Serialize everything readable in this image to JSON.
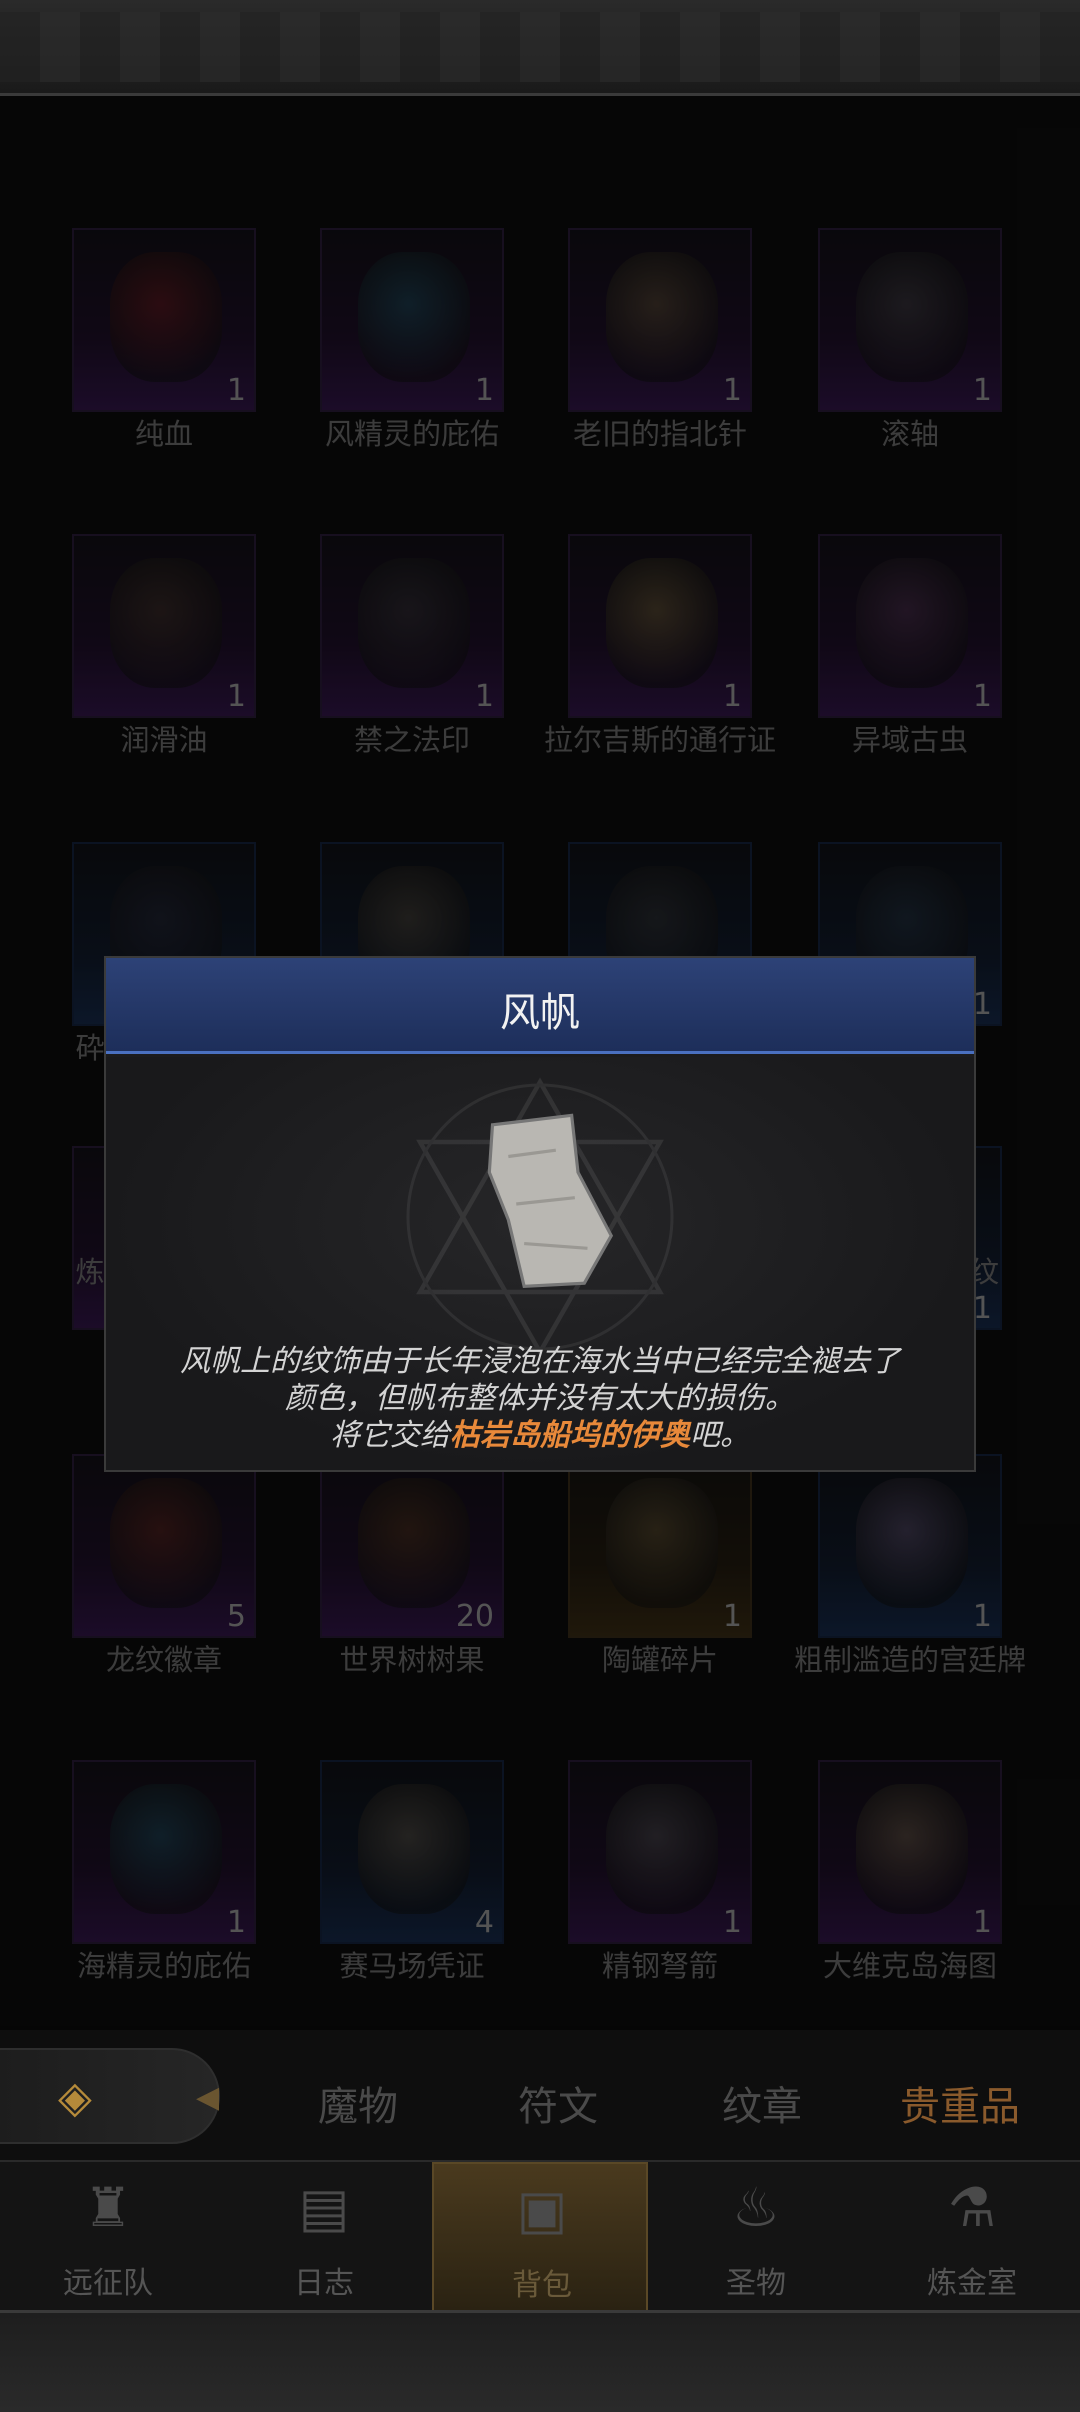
{
  "items": [
    {
      "name": "纯血",
      "qty": "1",
      "rarity": "purple",
      "color": "#7a1d1d"
    },
    {
      "name": "风精灵的庇佑",
      "qty": "1",
      "rarity": "purple",
      "color": "#1f5a6a"
    },
    {
      "name": "老旧的指北针",
      "qty": "1",
      "rarity": "purple",
      "color": "#6a5a3a"
    },
    {
      "name": "滚轴",
      "qty": "1",
      "rarity": "purple",
      "color": "#4a4a4a"
    },
    {
      "name": "润滑油",
      "qty": "1",
      "rarity": "purple",
      "color": "#4a3a2a"
    },
    {
      "name": "禁之法印",
      "qty": "1",
      "rarity": "purple",
      "color": "#3a3a3a"
    },
    {
      "name": "拉尔吉斯的通行证",
      "qty": "1",
      "rarity": "purple",
      "color": "#7a6a3a"
    },
    {
      "name": "异域古虫",
      "qty": "1",
      "rarity": "purple",
      "color": "#5a3a5a"
    },
    {
      "name": "",
      "qty": "",
      "rarity": "blue",
      "color": "#2a2a3a"
    },
    {
      "name": "",
      "qty": "",
      "rarity": "blue",
      "color": "#5a5040"
    },
    {
      "name": "",
      "qty": "",
      "rarity": "blue",
      "color": "#3a3a3a"
    },
    {
      "name": "",
      "qty": "1",
      "rarity": "blue",
      "color": "#2a3a4a"
    },
    {
      "name": "",
      "qty": "",
      "rarity": "purple",
      "color": "#2a2a2a"
    },
    {
      "name": "",
      "qty": "",
      "rarity": "purple",
      "color": "#2a2a2a"
    },
    {
      "name": "",
      "qty": "",
      "rarity": "purple",
      "color": "#2a2a2a"
    },
    {
      "name": "",
      "qty": "1",
      "rarity": "blue",
      "color": "#2a2a2a"
    },
    {
      "name": "龙纹徽章",
      "qty": "5",
      "rarity": "purple",
      "color": "#6a2a1a"
    },
    {
      "name": "世界树树果",
      "qty": "20",
      "rarity": "purple",
      "color": "#5a3a1a"
    },
    {
      "name": "陶罐碎片",
      "qty": "1",
      "rarity": "gold",
      "color": "#6a5a3a"
    },
    {
      "name": "粗制滥造的宫廷牌",
      "qty": "1",
      "rarity": "blue",
      "color": "#6a5a7a"
    },
    {
      "name": "海精灵的庇佑",
      "qty": "1",
      "rarity": "purple",
      "color": "#1f5a6a"
    },
    {
      "name": "赛马场凭证",
      "qty": "4",
      "rarity": "blue",
      "color": "#6a6050"
    },
    {
      "name": "精钢弩箭",
      "qty": "1",
      "rarity": "purple",
      "color": "#5a5a5a"
    },
    {
      "name": "大维克岛海图",
      "qty": "1",
      "rarity": "purple",
      "color": "#7a6a50"
    }
  ],
  "partial_labels": {
    "row3_left": "砕",
    "row4_left": "炼",
    "row4_right": "徽纹"
  },
  "dialog": {
    "title": "风帆",
    "desc_line1": "风帆上的纹饰由于长年浸泡在海水当中已经完全褪去了",
    "desc_line2": "颜色，但帆布整体并没有太大的损伤。",
    "desc_line3_pre": "将它交给",
    "desc_line3_hl": "枯岩岛船坞的伊奥",
    "desc_line3_post": "吧。",
    "highlight_color": "#e8893a"
  },
  "tabs": [
    {
      "label": "魔物"
    },
    {
      "label": "符文"
    },
    {
      "label": "纹章"
    },
    {
      "label": "贵重品"
    }
  ],
  "nav": [
    {
      "label": "远征队",
      "icon": "helmet-icon"
    },
    {
      "label": "日志",
      "icon": "scroll-icon"
    },
    {
      "label": "背包",
      "icon": "backpack-icon"
    },
    {
      "label": "圣物",
      "icon": "torch-icon"
    },
    {
      "label": "炼金室",
      "icon": "alchemy-icon"
    }
  ]
}
